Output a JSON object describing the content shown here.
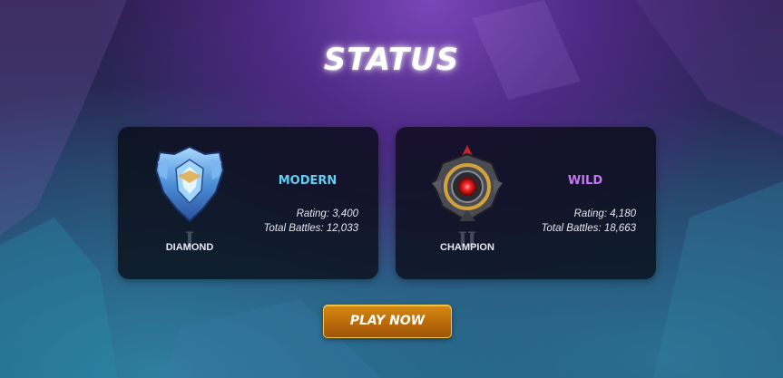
{
  "page": {
    "title": "STATUS"
  },
  "cards": [
    {
      "format": "MODERN",
      "rank": "DIAMOND",
      "tier": "I",
      "rating": "Rating: 3,400",
      "battles": "Total Battles: 12,033",
      "badge_icon": "diamond-rank-icon",
      "accent_color": "#5fd0f0"
    },
    {
      "format": "WILD",
      "rank": "CHAMPION",
      "tier": "II",
      "rating": "Rating: 4,180",
      "battles": "Total Battles: 18,663",
      "badge_icon": "champion-rank-icon",
      "accent_color": "#c777f0"
    }
  ],
  "actions": {
    "play_label": "PLAY NOW",
    "play_color": "#c27410"
  }
}
